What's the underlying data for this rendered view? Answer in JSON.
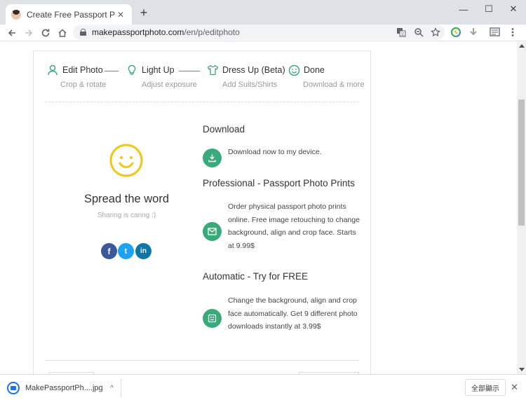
{
  "browser": {
    "tab_title": "Create Free Passport Photo",
    "tab_close": "✕",
    "new_tab": "+",
    "window_minimize": "—",
    "window_maximize": "☐",
    "window_close": "✕",
    "url_host": "makepassportphoto.com",
    "url_path": "/en/p/editphoto"
  },
  "steps": [
    {
      "label": "Edit Photo",
      "sub": "Crop & rotate",
      "icon": "person-icon"
    },
    {
      "label": "Light Up",
      "sub": "Adjust exposure",
      "icon": "lightbulb-icon"
    },
    {
      "label": "Dress Up (Beta)",
      "sub": "Add Suits/Shirts",
      "icon": "shirt-icon"
    },
    {
      "label": "Done",
      "sub": "Download & more",
      "icon": "smiley-icon"
    }
  ],
  "share": {
    "title": "Spread the word",
    "subtitle": "Sharing is caring :)",
    "facebook": "f",
    "twitter": "t",
    "linkedin": "in"
  },
  "sections": {
    "download": {
      "title": "Download",
      "text": "Download now to my device.",
      "icon": "download-icon"
    },
    "professional": {
      "title": "Professional - Passport Photo Prints",
      "text": "Order physical passport photo prints online. Free image retouching to change background, align and crop face. Starts at 9.99$",
      "icon": "mail-icon"
    },
    "automatic": {
      "title": "Automatic - Try for FREE",
      "text": "Change the background, align and crop face automatically. Get 9 different photo downloads instantly at 3.99$",
      "icon": "robot-icon"
    }
  },
  "download_shelf": {
    "file_name": "MakePassportPh....jpg",
    "chevron": "^",
    "show_all": "全部顯示",
    "close": "✕"
  },
  "colors": {
    "accent_green": "#3aaa7a",
    "smiley_yellow": "#f2c518",
    "facebook": "#3b5998",
    "twitter": "#1da1f2",
    "linkedin": "#0e76a8"
  }
}
